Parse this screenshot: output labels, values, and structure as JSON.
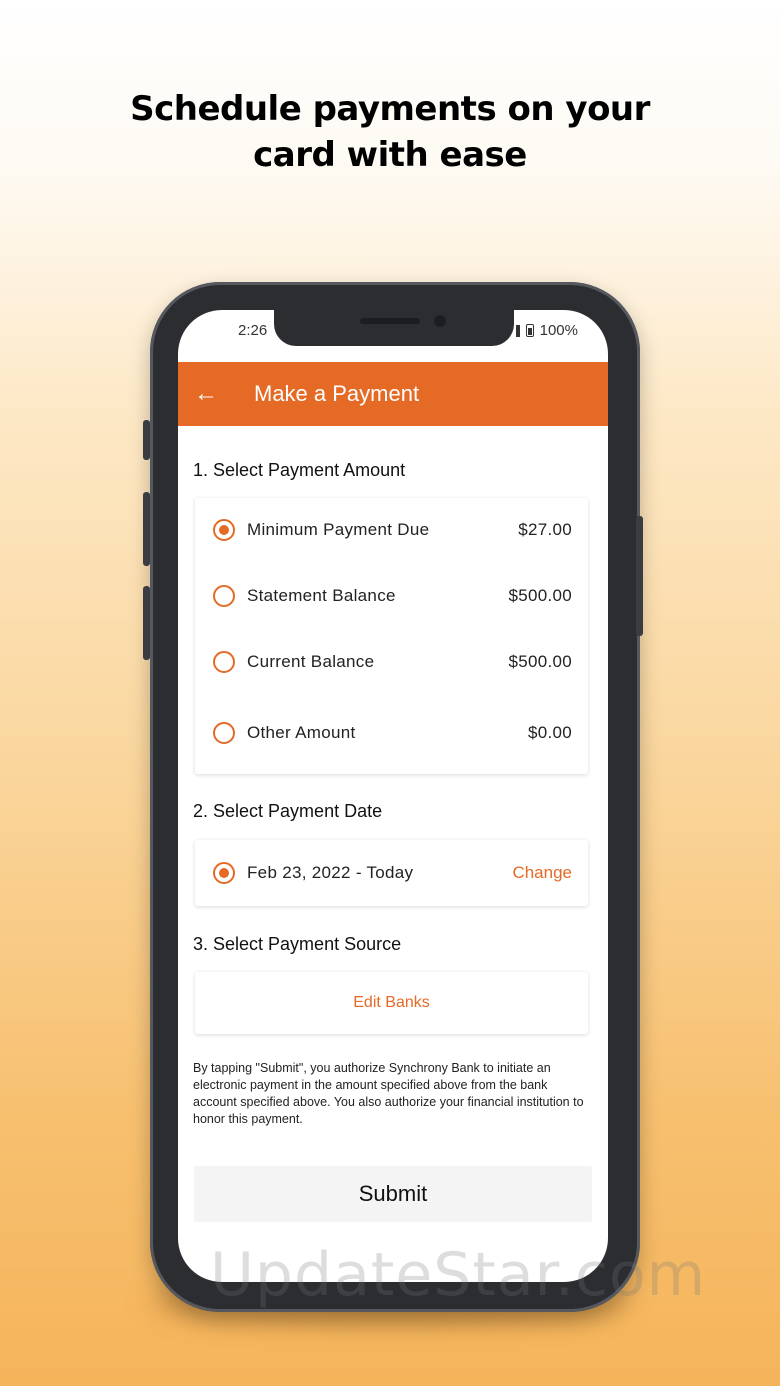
{
  "headline": {
    "line1": "Schedule payments on your",
    "line2": "card with ease"
  },
  "status_bar": {
    "time": "2:26",
    "battery": "100%"
  },
  "app_bar": {
    "back_icon": "arrow-left-icon",
    "title": "Make a Payment"
  },
  "payment_amount": {
    "section_title": "1. Select Payment Amount",
    "options": [
      {
        "label": "Minimum Payment Due",
        "value": "$27.00",
        "selected": true
      },
      {
        "label": "Statement Balance",
        "value": "$500.00",
        "selected": false
      },
      {
        "label": "Current Balance",
        "value": "$500.00",
        "selected": false
      },
      {
        "label": "Other Amount",
        "value": "$0.00",
        "selected": false
      }
    ]
  },
  "payment_date": {
    "section_title": "2. Select Payment Date",
    "date_label": "Feb 23, 2022 - Today",
    "change_label": "Change"
  },
  "payment_source": {
    "section_title": "3. Select Payment Source",
    "edit_banks_label": "Edit Banks"
  },
  "disclaimer": "By tapping \"Submit\", you authorize Synchrony Bank to initiate an electronic payment in the amount specified above from the bank account specified above. You also authorize your financial institution to honor this payment.",
  "submit_label": "Submit",
  "watermark": "UpdateStar.com",
  "colors": {
    "accent": "#e56a26",
    "background_top": "#ffffff",
    "background_bottom": "#f5b45a"
  }
}
